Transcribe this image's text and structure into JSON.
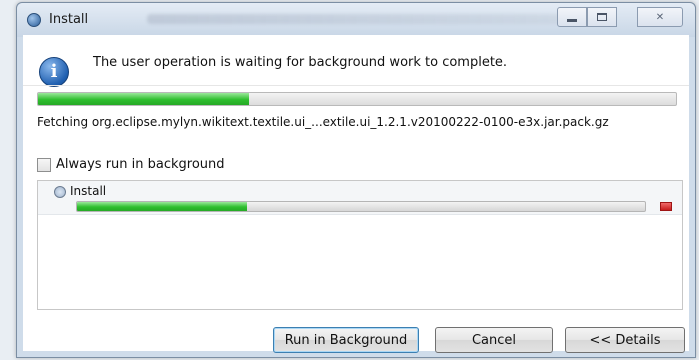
{
  "window": {
    "title": "Install"
  },
  "dialog": {
    "message": "The user operation is waiting for background work to complete.",
    "overall_progress": 0.33,
    "fetching_text": "Fetching org.eclipse.mylyn.wikitext.textile.ui_...extile.ui_1.2.1.v20100222-0100-e3x.jar.pack.gz",
    "always_run_label": "Always run in background",
    "always_run_checked": false
  },
  "task": {
    "name": "Install",
    "progress": 0.3
  },
  "buttons": {
    "run_in_background": "Run in Background",
    "cancel": "Cancel",
    "details": "<< Details"
  },
  "colors": {
    "progress_green": "#2fbf2f",
    "stop_red": "#c71d1d",
    "info_blue": "#1f5fb0"
  }
}
